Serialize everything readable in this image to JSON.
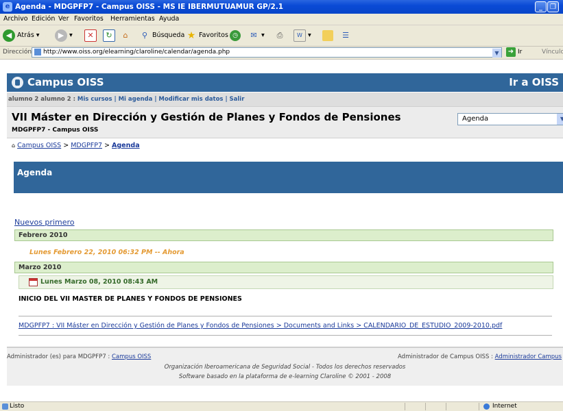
{
  "window": {
    "title": "Agenda - MDGPFP7 - Campus OISS - MS IE IBERMUTUAMUR GP/2.1",
    "min": "_",
    "max": "❐"
  },
  "menu": [
    "Archivo",
    "Edición",
    "Ver",
    "Favoritos",
    "Herramientas",
    "Ayuda"
  ],
  "toolbar": {
    "back": "Atrás",
    "search": "Búsqueda",
    "favorites": "Favoritos"
  },
  "address": {
    "label": "Dirección",
    "url": "http://www.oiss.org/elearning/claroline/calendar/agenda.php",
    "go": "Ir",
    "links": "Vínculos"
  },
  "banner": {
    "site": "Campus OISS",
    "goto": "Ir a OISS"
  },
  "userbar": {
    "user": "alumno 2 alumno 2 : ",
    "links": "Mis cursos | Mi agenda | Modificar mis datos | Salir"
  },
  "course": {
    "title": "VII Máster en Dirección y Gestión de Planes y Fondos de Pensiones",
    "subtitle": "MDGPFP7 - Campus OISS",
    "tool_select": "Agenda"
  },
  "breadcrumb": {
    "home": "Campus OISS",
    "sep": " > ",
    "course": "MDGPFP7",
    "current": "Agenda"
  },
  "agenda": {
    "heading": "Agenda",
    "order_link": "Nuevos primero",
    "month1": "Febrero 2010",
    "now_marker": "Lunes Febrero 22, 2010 06:32 PM -- Ahora",
    "month2": "Marzo 2010",
    "event_date": "Lunes Marzo 08, 2010 08:43 AM",
    "event_title": "INICIO DEL VII MASTER DE PLANES Y FONDOS DE PENSIONES",
    "event_link": "MDGPFP7 : VII Máster en Dirección y Gestión de Planes y Fondos de Pensiones > Documents and Links > CALENDARIO_DE_ESTUDIO_2009-2010.pdf"
  },
  "footer": {
    "left_label": "Administrador (es) para MDGPFP7 : ",
    "left_link": "Campus OISS",
    "right_label": "Administrador de Campus OISS : ",
    "right_link": "Administrador Campus",
    "line1": "Organización Iberoamericana de Seguridad Social - Todos los derechos reservados",
    "line2": "Software basado en la plataforma de e-learning Claroline © 2001 - 2008"
  },
  "status": {
    "left": "Listo",
    "zone": "Internet"
  },
  "colors": {
    "header_blue": "#30669a",
    "month_green": "#dceecc",
    "now_orange": "#e49a33"
  }
}
